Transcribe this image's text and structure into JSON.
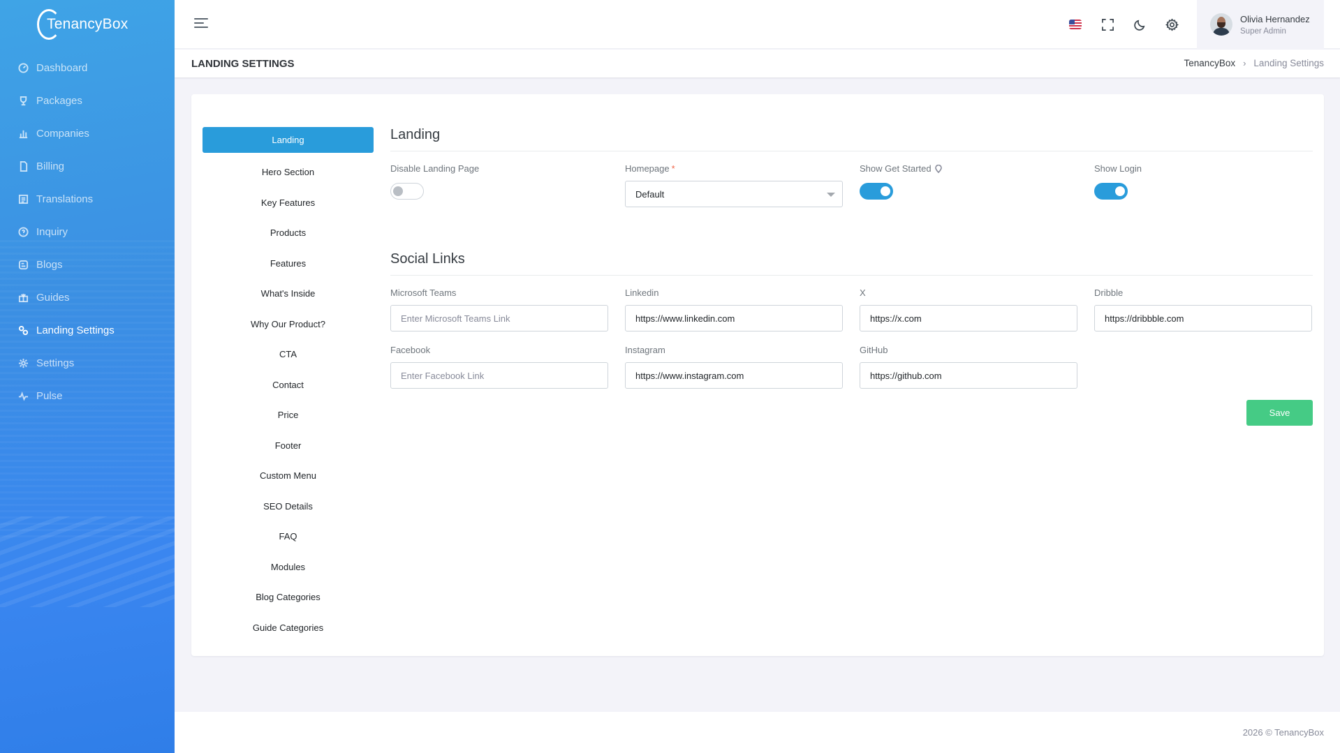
{
  "brand": {
    "name": "TenancyBox"
  },
  "sidebar": {
    "items": [
      {
        "label": "Dashboard",
        "icon": "dashboard-icon"
      },
      {
        "label": "Packages",
        "icon": "trophy-icon"
      },
      {
        "label": "Companies",
        "icon": "bar-chart-icon"
      },
      {
        "label": "Billing",
        "icon": "file-icon"
      },
      {
        "label": "Translations",
        "icon": "translate-icon"
      },
      {
        "label": "Inquiry",
        "icon": "question-icon"
      },
      {
        "label": "Blogs",
        "icon": "blog-icon"
      },
      {
        "label": "Guides",
        "icon": "guide-icon"
      },
      {
        "label": "Landing Settings",
        "icon": "settings-cog-icon",
        "active": true
      },
      {
        "label": "Settings",
        "icon": "gear-icon"
      },
      {
        "label": "Pulse",
        "icon": "pulse-icon"
      }
    ]
  },
  "topbar": {
    "user_name": "Olivia Hernandez",
    "user_role": "Super Admin",
    "language_flag": "us-flag-icon"
  },
  "page": {
    "title": "LANDING SETTINGS",
    "breadcrumb": [
      "TenancyBox",
      "Landing Settings"
    ]
  },
  "tabs": [
    "Landing",
    "Hero Section",
    "Key Features",
    "Products",
    "Features",
    "What's Inside",
    "Why Our Product?",
    "CTA",
    "Contact",
    "Price",
    "Footer",
    "Custom Menu",
    "SEO Details",
    "FAQ",
    "Modules",
    "Blog Categories",
    "Guide Categories"
  ],
  "landing": {
    "section_title": "Landing",
    "disable_label": "Disable Landing Page",
    "disable_value": false,
    "homepage_label": "Homepage",
    "homepage_required": "*",
    "homepage_value": "Default",
    "get_started_label": "Show Get Started",
    "get_started_value": true,
    "login_label": "Show Login",
    "login_value": true
  },
  "social": {
    "section_title": "Social Links",
    "fields": [
      {
        "label": "Microsoft Teams",
        "value": "",
        "placeholder": "Enter Microsoft Teams Link"
      },
      {
        "label": "Linkedin",
        "value": "https://www.linkedin.com",
        "placeholder": ""
      },
      {
        "label": "X",
        "value": "https://x.com",
        "placeholder": ""
      },
      {
        "label": "Dribble",
        "value": "https://dribbble.com",
        "placeholder": ""
      },
      {
        "label": "Facebook",
        "value": "",
        "placeholder": "Enter Facebook Link"
      },
      {
        "label": "Instagram",
        "value": "https://www.instagram.com",
        "placeholder": ""
      },
      {
        "label": "GitHub",
        "value": "https://github.com",
        "placeholder": ""
      }
    ],
    "save_label": "Save"
  },
  "colors": {
    "primary": "#299cdb",
    "success": "#45cb85",
    "sidebar_gradient_start": "#3fa4e6",
    "sidebar_gradient_end": "#2f7ee8"
  },
  "footer": {
    "text": "2026 © TenancyBox"
  }
}
